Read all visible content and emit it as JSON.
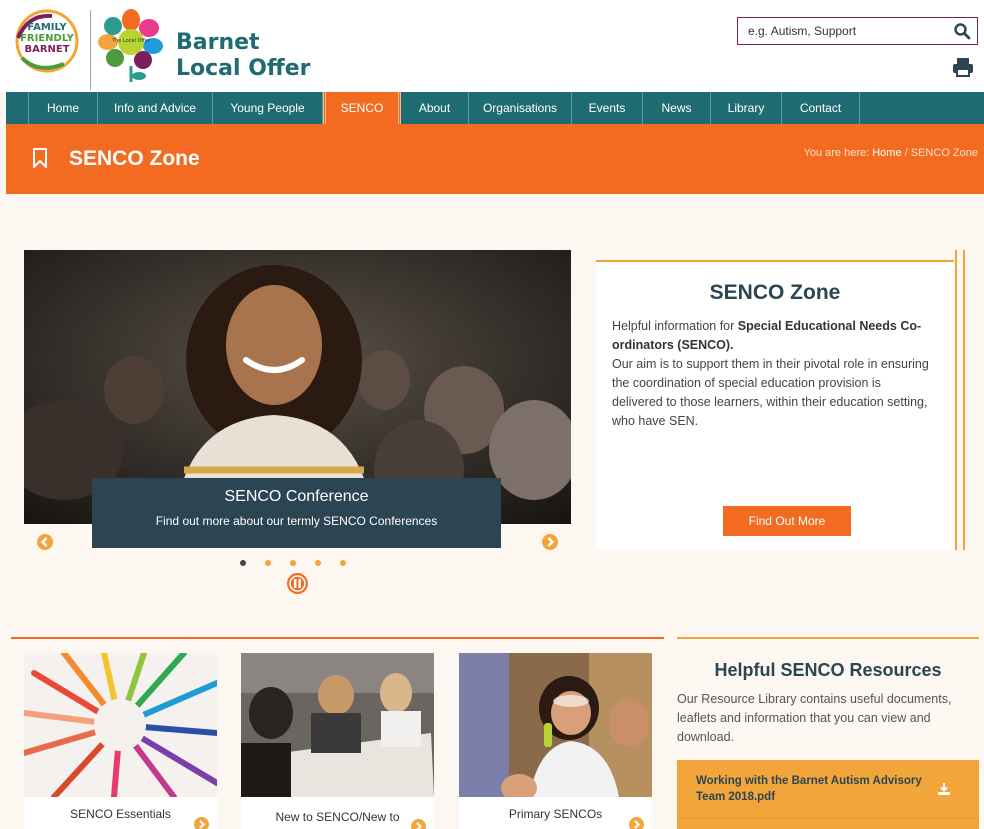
{
  "header": {
    "ff_logo_text": [
      "FAMILY",
      "FRIENDLY",
      "BARNET"
    ],
    "flower_center_text": "The Local Offer",
    "brand_line1": "Barnet",
    "brand_line2": "Local Offer",
    "search": {
      "value": "e.g. Autism, Support",
      "icon": "search-icon"
    },
    "print_icon": "print-icon"
  },
  "nav": {
    "items": [
      {
        "label": "Home",
        "width": 70
      },
      {
        "label": "Info and Advice",
        "width": 115
      },
      {
        "label": "Young People",
        "width": 110
      },
      {
        "label": "SENCO",
        "width": 78,
        "active": true
      },
      {
        "label": "About",
        "width": 68
      },
      {
        "label": "Organisations",
        "width": 103
      },
      {
        "label": "Events",
        "width": 71
      },
      {
        "label": "News",
        "width": 68
      },
      {
        "label": "Library",
        "width": 71
      },
      {
        "label": "Contact",
        "width": 78
      }
    ]
  },
  "banner": {
    "title": "SENCO Zone",
    "breadcrumb_prefix": "You are here:",
    "breadcrumb_home": "Home",
    "breadcrumb_rest": "/ SENCO Zone"
  },
  "slider": {
    "caption_title": "SENCO Conference",
    "caption_sub": "Find out more about our termly SENCO Conferences",
    "slide_count": 5,
    "current_slide": 1
  },
  "info": {
    "title": "SENCO Zone",
    "intro": "Helpful information for",
    "intro_bold": "Special Educational Needs Co-ordinators (SENCO).",
    "body": "Our aim is to support them in their pivotal role in ensuring the coordination of special education provision is delivered to those learners, within their education setting, who have SEN.",
    "button": "Find Out More"
  },
  "cards": [
    {
      "label": "SENCO Essentials"
    },
    {
      "label": "New to SENCO/New to"
    },
    {
      "label": "Primary SENCOs"
    }
  ],
  "resources": {
    "title": "Helpful SENCO Resources",
    "text": "Our Resource Library contains useful documents, leaflets and information that you can view and download.",
    "items": [
      {
        "label": "Working with the Barnet Autism Advisory Team 2018.pdf"
      }
    ]
  },
  "colors": {
    "teal": "#1f6b72",
    "orange": "#f26b21",
    "gold": "#f1a53a",
    "navy": "#2c4552"
  }
}
